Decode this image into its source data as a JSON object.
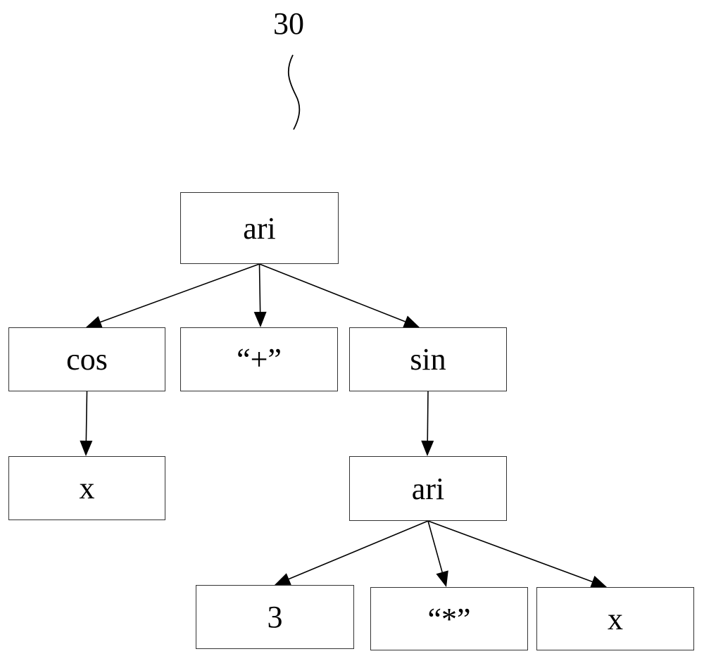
{
  "reference_label": "30",
  "tree": {
    "nodes": [
      {
        "id": "root",
        "label": "ari"
      },
      {
        "id": "cos",
        "label": "cos"
      },
      {
        "id": "plus",
        "label": "“+”"
      },
      {
        "id": "sin",
        "label": "sin"
      },
      {
        "id": "x1",
        "label": "x"
      },
      {
        "id": "ari2",
        "label": "ari"
      },
      {
        "id": "three",
        "label": "3"
      },
      {
        "id": "times",
        "label": "“*”"
      },
      {
        "id": "x2",
        "label": "x"
      }
    ],
    "edges": [
      [
        "root",
        "cos"
      ],
      [
        "root",
        "plus"
      ],
      [
        "root",
        "sin"
      ],
      [
        "cos",
        "x1"
      ],
      [
        "sin",
        "ari2"
      ],
      [
        "ari2",
        "three"
      ],
      [
        "ari2",
        "times"
      ],
      [
        "ari2",
        "x2"
      ]
    ]
  }
}
